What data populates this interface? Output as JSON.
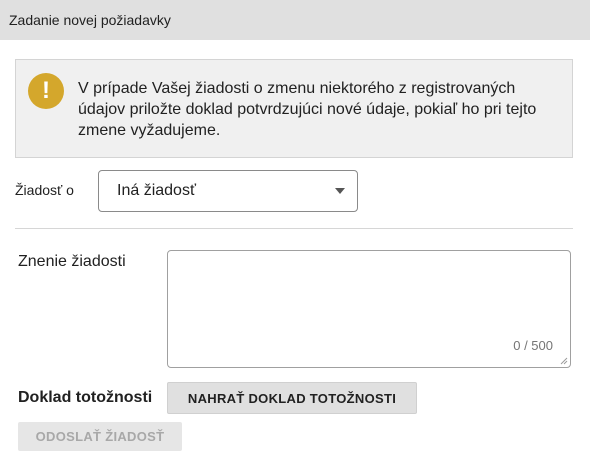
{
  "header": {
    "title": "Zadanie novej požiadavky"
  },
  "alert": {
    "icon": "exclamation-icon",
    "icon_glyph": "!",
    "icon_color": "#d4a72c",
    "text": "V prípade Vašej žiadosti o zmenu niektorého z registrovaných údajov priložte doklad potvrdzujúci nové údaje, pokiaľ ho pri tejto zmene vyžadujeme."
  },
  "request_type": {
    "label": "Žiadosť o",
    "selected": "Iná žiadosť"
  },
  "request_text": {
    "label": "Znenie žiadosti",
    "value": "",
    "counter": "0 / 500"
  },
  "identity_doc": {
    "label": "Doklad totožnosti",
    "upload_button": "NAHRAŤ DOKLAD TOTOŽNOSTI"
  },
  "submit": {
    "label": "ODOSLAŤ ŽIADOSŤ",
    "disabled": true
  }
}
